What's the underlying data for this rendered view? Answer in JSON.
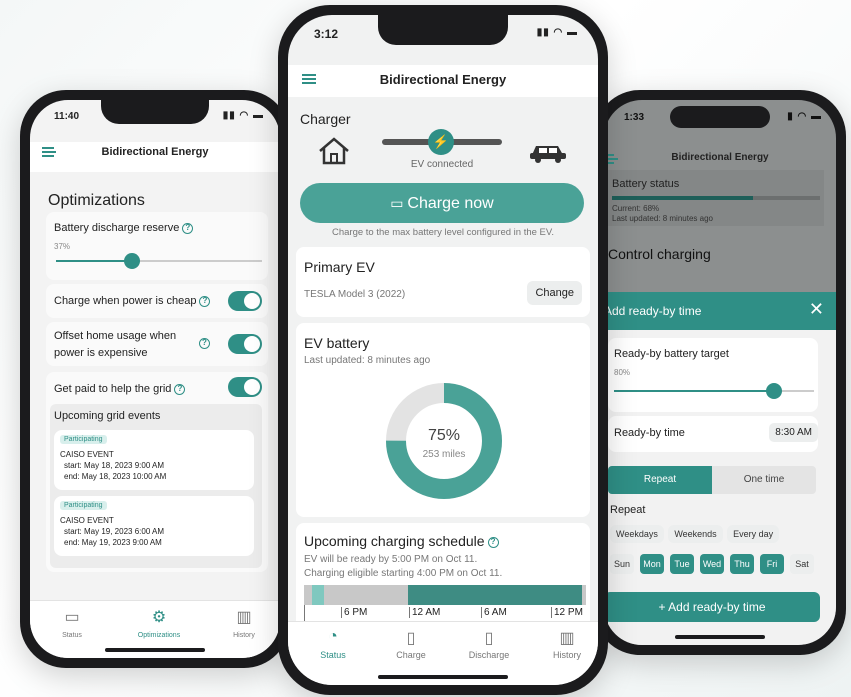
{
  "left_phone": {
    "status_time": "11:40",
    "app_title": "Bidirectional Energy",
    "section_title": "Optimizations",
    "discharge_label": "Battery discharge reserve",
    "discharge_value": "37%",
    "discharge_level": 0.37,
    "cheap_label": "Charge when power is cheap",
    "offset_label_1": "Offset home usage when",
    "offset_label_2": "power is expensive",
    "grid_label": "Get paid to help the grid",
    "events_title": "Upcoming grid events",
    "events": [
      {
        "badge": "Participating",
        "name": "CAISO EVENT",
        "start": "start: May 18, 2023 9:00 AM",
        "end": "end: May 18, 2023 10:00 AM"
      },
      {
        "badge": "Participating",
        "name": "CAISO EVENT",
        "start": "start: May 19, 2023 6:00 AM",
        "end": "end: May 19, 2023 9:00 AM"
      }
    ],
    "tabs": [
      "Status",
      "Optimizations",
      "History"
    ]
  },
  "mid_phone": {
    "status_time": "3:12",
    "app_title": "Bidirectional Energy",
    "charger_title": "Charger",
    "ev_connected": "EV connected",
    "charge_now": "Charge now",
    "charge_note": "Charge to the max battery level configured in the EV.",
    "primary_ev_title": "Primary EV",
    "ev_model": "TESLA Model 3 (2022)",
    "change_label": "Change",
    "battery_title": "EV battery",
    "battery_updated": "Last updated: 8 minutes ago",
    "battery_percent": "75%",
    "battery_level": 0.75,
    "battery_miles": "253 miles",
    "schedule_title": "Upcoming charging schedule",
    "schedule_line1": "EV will be ready by 5:00 PM on Oct 11.",
    "schedule_line2": "Charging eligible starting 4:00 PM on Oct 11.",
    "timeline_labels": [
      "6 PM",
      "12 AM",
      "6 AM",
      "12 PM"
    ],
    "tabs": [
      "Status",
      "Charge",
      "Discharge",
      "History"
    ]
  },
  "right_phone": {
    "status_time": "1:33",
    "app_title": "Bidirectional Energy",
    "battery_status": "Battery status",
    "battery_current": "Current: 68%",
    "battery_updated": "Last updated: 8 minutes ago",
    "control_charging": "Control charging",
    "modal_title": "Add ready-by time",
    "target_label": "Ready-by battery target",
    "target_value": "80%",
    "target_level": 0.8,
    "time_label": "Ready-by time",
    "time_value": "8:30 AM",
    "repeat_tab": "Repeat",
    "one_time_tab": "One time",
    "repeat_label": "Repeat",
    "repeat_presets": [
      "Weekdays",
      "Weekends",
      "Every day"
    ],
    "days": [
      {
        "label": "Sun",
        "on": false
      },
      {
        "label": "Mon",
        "on": true
      },
      {
        "label": "Tue",
        "on": true
      },
      {
        "label": "Wed",
        "on": true
      },
      {
        "label": "Thu",
        "on": true
      },
      {
        "label": "Fri",
        "on": true
      },
      {
        "label": "Sat",
        "on": false
      }
    ],
    "add_button": "Add ready-by time"
  },
  "colors": {
    "accent": "#2f8f86",
    "accent_light": "#7fc8bf",
    "bg": "#f1f2f2"
  },
  "icons": [
    "menu-icon",
    "help-icon",
    "house-icon",
    "car-icon",
    "plug-icon",
    "battery-icon",
    "gear-icon",
    "bar-chart-icon",
    "gauge-icon",
    "close-icon",
    "plus-icon"
  ]
}
